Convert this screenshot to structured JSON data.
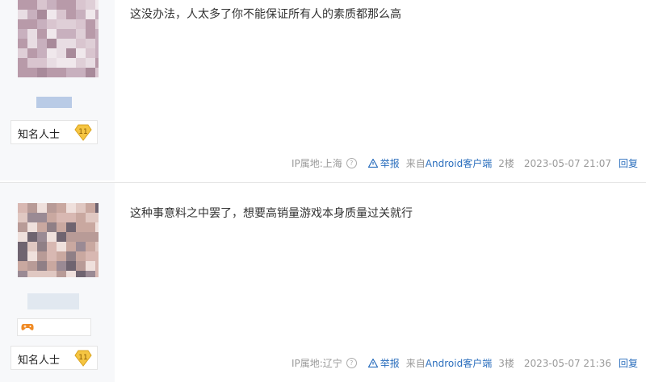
{
  "posts": [
    {
      "content": "这没办法，人太多了你不能保证所有人的素质都那么高",
      "badge_label": "知名人士",
      "badge_level": "11",
      "ip_label": "IP属地:上海",
      "report_label": "举报",
      "client_label": "来自Android客户端",
      "floor": "2楼",
      "timestamp": "2023-05-07 21:07",
      "reply_label": "回复"
    },
    {
      "content": "这种事意料之中罢了，想要高销量游戏本身质量过关就行",
      "badge_label": "知名人士",
      "badge_level": "11",
      "ip_label": "IP属地:辽宁",
      "report_label": "举报",
      "client_label": "来自Android客户端",
      "floor": "3楼",
      "timestamp": "2023-05-07 21:36",
      "reply_label": "回复"
    }
  ],
  "colors": {
    "link": "#2a6ebd",
    "meta": "#999999",
    "sidebar": "#f7f8fa",
    "badge_gold": "#f5c542"
  },
  "icons": {
    "help": "question-circle-icon",
    "report": "warning-triangle-icon",
    "level": "diamond-level-icon",
    "game": "gamepad-icon"
  }
}
